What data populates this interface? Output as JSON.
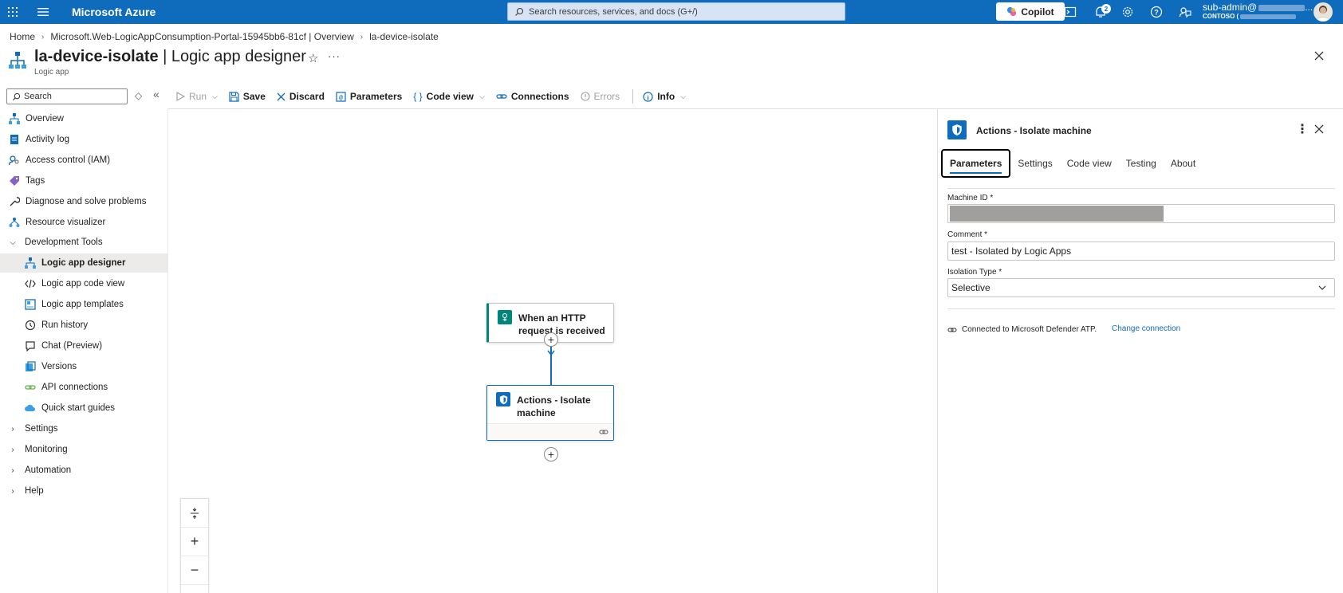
{
  "topbar": {
    "brand": "Microsoft Azure",
    "search_placeholder": "Search resources, services, and docs (G+/)",
    "copilot_label": "Copilot",
    "notification_count": "2",
    "user_name": "sub-admin@",
    "user_tenant": "CONTOSO (",
    "user_name_suffix": "..."
  },
  "breadcrumb": {
    "items": [
      "Home",
      "Microsoft.Web-LogicAppConsumption-Portal-15945bb6-81cf | Overview",
      "la-device-isolate"
    ]
  },
  "header": {
    "title_bold": "la-device-isolate",
    "title_rest": " | Logic app designer",
    "subtitle": "Logic app"
  },
  "sidebar": {
    "search_placeholder": "Search",
    "items": [
      {
        "label": "Overview"
      },
      {
        "label": "Activity log"
      },
      {
        "label": "Access control (IAM)"
      },
      {
        "label": "Tags"
      },
      {
        "label": "Diagnose and solve problems"
      },
      {
        "label": "Resource visualizer"
      },
      {
        "label": "Development Tools"
      },
      {
        "label": "Logic app designer"
      },
      {
        "label": "Logic app code view"
      },
      {
        "label": "Logic app templates"
      },
      {
        "label": "Run history"
      },
      {
        "label": "Chat (Preview)"
      },
      {
        "label": "Versions"
      },
      {
        "label": "API connections"
      },
      {
        "label": "Quick start guides"
      },
      {
        "label": "Settings"
      },
      {
        "label": "Monitoring"
      },
      {
        "label": "Automation"
      },
      {
        "label": "Help"
      }
    ]
  },
  "toolbar": {
    "run": "Run",
    "save": "Save",
    "discard": "Discard",
    "parameters": "Parameters",
    "code_view": "Code view",
    "connections": "Connections",
    "errors": "Errors",
    "info": "Info"
  },
  "canvas": {
    "trigger_title": "When an HTTP request is received",
    "action_title": "Actions - Isolate machine"
  },
  "panel": {
    "title": "Actions - Isolate machine",
    "tabs": [
      "Parameters",
      "Settings",
      "Code view",
      "Testing",
      "About"
    ],
    "machine_id_label": "Machine ID *",
    "comment_label": "Comment *",
    "comment_value": "test - Isolated by Logic Apps",
    "isolation_label": "Isolation Type *",
    "isolation_value": "Selective",
    "connection_text": "Connected to Microsoft Defender ATP.",
    "change_connection": "Change connection"
  }
}
